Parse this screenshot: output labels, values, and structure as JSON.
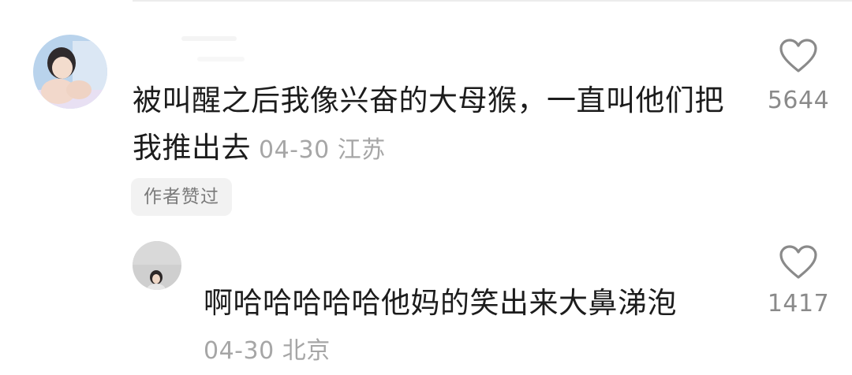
{
  "comment": {
    "text": "被叫醒之后我像兴奋的大母猴，一直叫他们把我推出去",
    "date": "04-30",
    "location": "江苏",
    "author_liked_label": "作者赞过",
    "like_count": "5644",
    "like_icon": "heart-outline-icon"
  },
  "reply": {
    "text": "啊哈哈哈哈哈他妈的笑出来大鼻涕泡",
    "date": "04-30",
    "location": "北京",
    "like_count": "1417",
    "like_icon": "heart-outline-icon"
  },
  "colors": {
    "text_primary": "#1c1c1c",
    "text_meta": "#a6a6a6",
    "badge_bg": "#f2f2f2",
    "icon_stroke": "#8a8a8a"
  }
}
